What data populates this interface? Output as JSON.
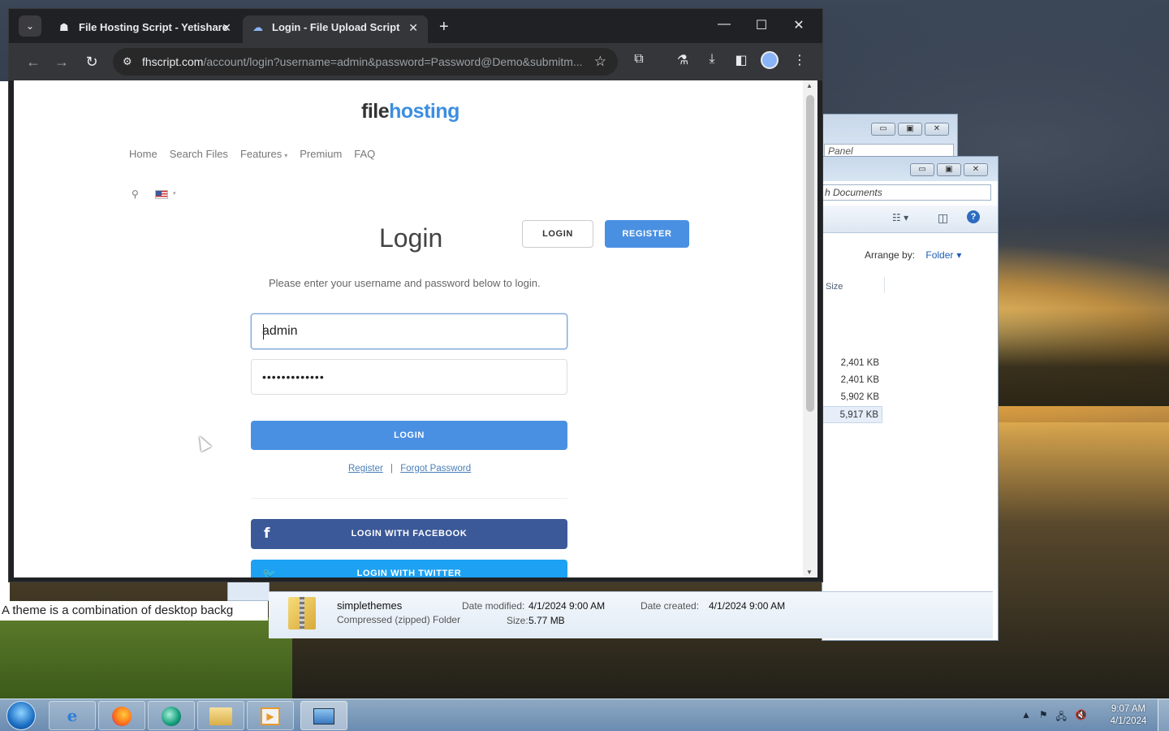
{
  "browser": {
    "tabs": [
      {
        "title": "File Hosting Script - Yetishare",
        "active": false
      },
      {
        "title": "Login - File Upload Script",
        "active": true
      }
    ],
    "url_domain": "fhscript.com",
    "url_path": "/account/login?username=admin&password=Password@Demo&submitm..."
  },
  "page": {
    "logo_part1": "file",
    "logo_part2": "hosting",
    "nav": [
      "Home",
      "Search Files",
      "Features",
      "Premium",
      "FAQ"
    ],
    "header_login": "LOGIN",
    "header_register": "REGISTER",
    "title": "Login",
    "instructions": "Please enter your username and password below to login.",
    "username_value": "admin",
    "password_value": "•••••••••••••",
    "login_button": "LOGIN",
    "register_link": "Register",
    "link_separator": "|",
    "forgot_link": "Forgot Password",
    "facebook_button": "LOGIN WITH FACEBOOK",
    "twitter_button": "LOGIN WITH TWITTER"
  },
  "explorer": {
    "panel_search": "Panel",
    "doc_search": "h Documents",
    "arrange_label": "Arrange by:",
    "arrange_value": "Folder",
    "column_size": "Size",
    "sizes": [
      "2,401 KB",
      "2,401 KB",
      "5,902 KB",
      "5,917 KB"
    ],
    "details": {
      "name": "simplethemes",
      "type": "Compressed (zipped) Folder",
      "date_modified_label": "Date modified:",
      "date_modified": "4/1/2024 9:00 AM",
      "size_label": "Size:",
      "size": "5.77 MB",
      "date_created_label": "Date created:",
      "date_created": "4/1/2024 9:00 AM"
    }
  },
  "background_text": "A theme is a combination of desktop backg",
  "taskbar": {
    "time": "9:07 AM",
    "date": "4/1/2024"
  }
}
